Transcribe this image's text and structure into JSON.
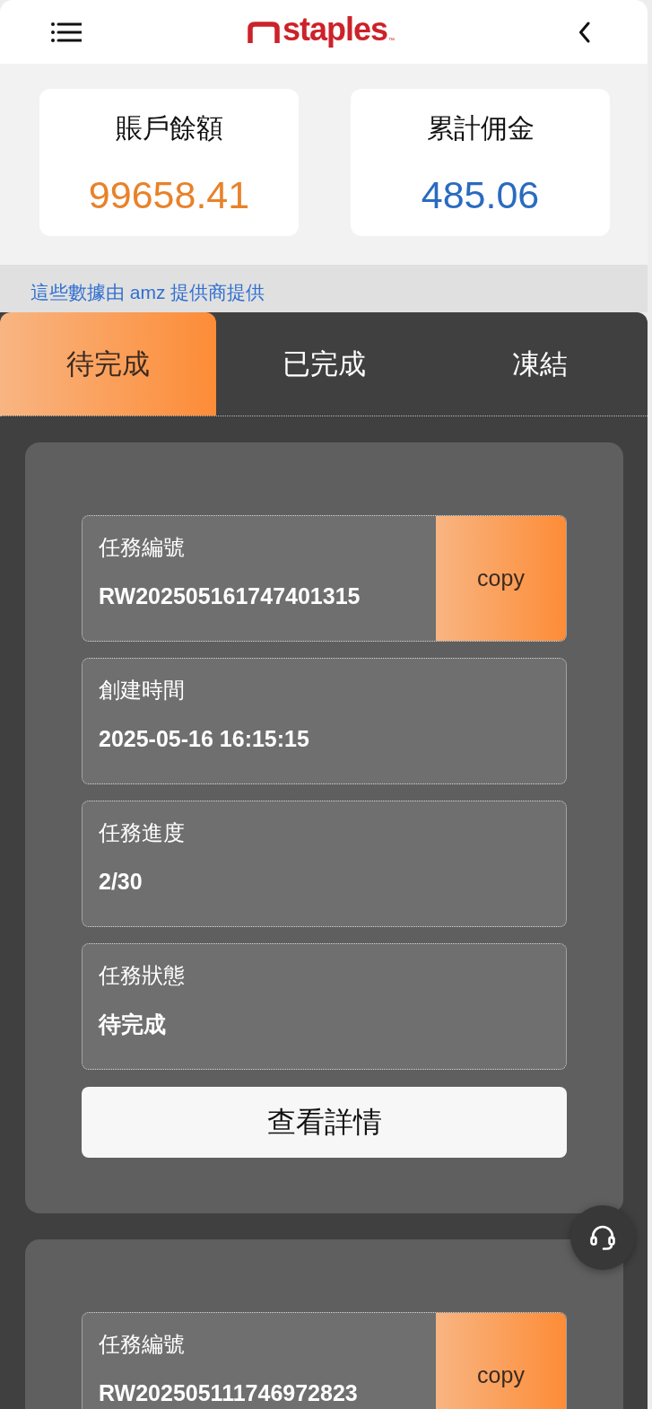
{
  "header": {
    "brand": "staples",
    "brand_mark": "™"
  },
  "stats": [
    {
      "label": "賬戶餘額",
      "value": "99658.41",
      "color": "#e8822a"
    },
    {
      "label": "累計佣金",
      "value": "485.06",
      "color": "#2a6bc0"
    }
  ],
  "notice": "這些數據由 amz 提供商提供",
  "tabs": [
    {
      "label": "待完成",
      "selected": true
    },
    {
      "label": "已完成",
      "selected": false
    },
    {
      "label": "凍結",
      "selected": false
    }
  ],
  "tasks": [
    {
      "fields": [
        {
          "kind": "copyable",
          "label": "任務編號",
          "value": "RW202505161747401315",
          "action": "copy"
        },
        {
          "kind": "plain",
          "label": "創建時間",
          "value": "2025-05-16 16:15:15"
        },
        {
          "kind": "plain",
          "label": "任務進度",
          "value": "2/30"
        },
        {
          "kind": "plain",
          "label": "任務狀態",
          "value": "待完成"
        }
      ],
      "button": "查看詳情"
    },
    {
      "fields": [
        {
          "kind": "copyable",
          "label": "任務編號",
          "value": "RW202505111746972823",
          "action": "copy"
        }
      ]
    }
  ]
}
